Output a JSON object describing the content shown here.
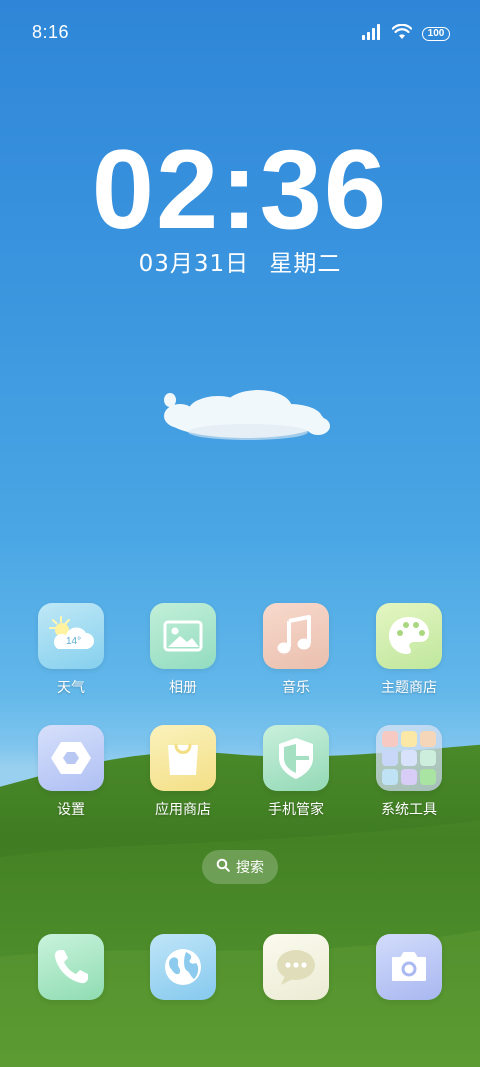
{
  "status_bar": {
    "time": "8:16",
    "battery": "100",
    "icons": [
      "signal-icon",
      "wifi-icon",
      "battery-icon"
    ]
  },
  "clock": {
    "time": "02:36",
    "date": "03月31日",
    "weekday": "星期二"
  },
  "apps": {
    "row1": [
      {
        "label": "天气",
        "icon": "weather-icon",
        "temp": "14°"
      },
      {
        "label": "相册",
        "icon": "gallery-icon"
      },
      {
        "label": "音乐",
        "icon": "music-icon"
      },
      {
        "label": "主题商店",
        "icon": "theme-store-icon"
      }
    ],
    "row2": [
      {
        "label": "设置",
        "icon": "settings-icon"
      },
      {
        "label": "应用商店",
        "icon": "app-store-icon"
      },
      {
        "label": "手机管家",
        "icon": "security-icon"
      },
      {
        "label": "系统工具",
        "icon": "folder-icon"
      }
    ]
  },
  "search": {
    "label": "搜索",
    "icon": "search-icon"
  },
  "dock": [
    {
      "icon": "phone-icon"
    },
    {
      "icon": "browser-icon"
    },
    {
      "icon": "message-icon"
    },
    {
      "icon": "camera-icon"
    }
  ],
  "colors": {
    "sky_top": "#2f86d8",
    "grass": "#3f7a22"
  }
}
